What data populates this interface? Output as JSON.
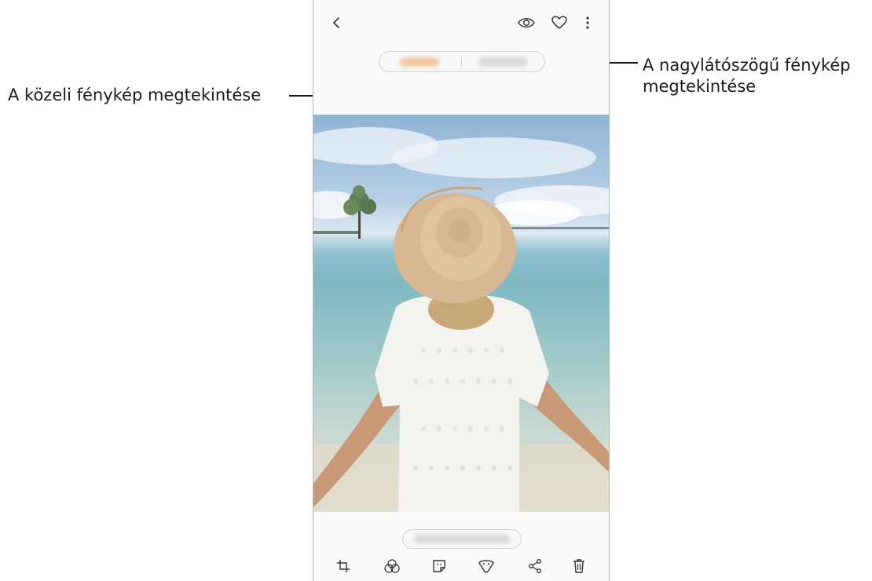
{
  "annotations": {
    "close_up_label": "A közeli fénykép megtekintése",
    "wide_angle_label_line1": "A nagylátószögű fénykép",
    "wide_angle_label_line2": "megtekintése"
  },
  "toolbar_top": {
    "icons": [
      "back-icon",
      "bixby-vision-icon",
      "favorite-heart-icon",
      "more-options-icon"
    ]
  },
  "view_toggle": {
    "segments": [
      "close-up-view",
      "wide-angle-view"
    ],
    "selected": "close-up-view"
  },
  "toolbar_bottom": {
    "icons": [
      "crop-rotate-icon",
      "filter-icon",
      "sticker-icon",
      "decoration-icon",
      "share-icon",
      "delete-icon"
    ]
  },
  "colors": {
    "accent_selected": "#f2c9a5",
    "text": "#1a1a1a",
    "phone_border": "#b5b5b5"
  }
}
